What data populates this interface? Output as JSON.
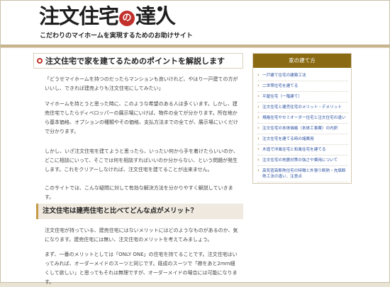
{
  "header": {
    "logo_text_before": "注文住宅",
    "logo_circle_char": "の",
    "logo_text_after": "達人",
    "tagline": "こだわりのマイホームを実現するためのお助けサイト"
  },
  "article": {
    "title": "注文住宅で家を建てるためのポイントを解説します",
    "paragraphs": [
      "「どうせマイホームを持つのだったらマンションも良いけれど、やはり一戸建ての方がいいし、できれば建売よりも注文住宅にしてみたい」",
      "マイホームを持とうと思った時に、このような希望のある人は多くいます。しかし、建売住宅でしたらディベロッパーの展示場にいけば、物件の全てが分かります。所在地から基本価格、オプションの種類やその価格、支払方法までの全てが、展示場にいくだけで分かります。",
      "しかし、いざ注文住宅を建てようと思ったら、いったい何から手を着けたらいいのか、どこに相談にいって、そこでは何を相談すればいいのか分からない、という問題が発生します。これをクリアーしなければ、注文住宅を建てることが出来ません。",
      "このサイトでは、こんな疑問に対して有効な解決方法を分かりやすく解説していきます。"
    ],
    "section_heading": "注文住宅は建売住宅と比べてどんな点がメリット？",
    "section_paragraphs": [
      "注文住宅が持っている、建売住宅にはないメリットにはどのようなものがあるのか、気になります。建売住宅には無い、注文住宅のメリットを考えてみましょう。",
      "まず、一番のメリットとしては「ONLY ONE」の住宅を持てることです。注文住宅はいってみれば、オーダーメイドのスーツと同じです。既成のスーツで「襟をあと2mm細くして欲しい」と思ってもそれは無理ですが、オーダーメイドの場合には可能になります。"
    ]
  },
  "sidebar": {
    "heading": "家の建て方",
    "items": [
      "一戸建て住宅の建築工法",
      "二世帯住宅を建てる",
      "平屋住宅（一階建て）",
      "注文住宅と建売住宅のメリット・デメリット",
      "規格住宅やセミオーダー住宅と注文住宅の違い",
      "注文住宅の本体価格（本体工事費）の内訳",
      "注文住宅を建てる時の諸費用",
      "木造で洋風住宅と和風住宅を建てる",
      "注文住宅の地震対策の強さや費用について",
      "高気密高断熱住宅の特徴と外張り断熱・充填断熱工法の違い、注意点"
    ]
  },
  "colors": {
    "accent_red": "#c2302b",
    "sidebar_brown": "#8a6a12",
    "link_blue": "#2a4fa0"
  }
}
